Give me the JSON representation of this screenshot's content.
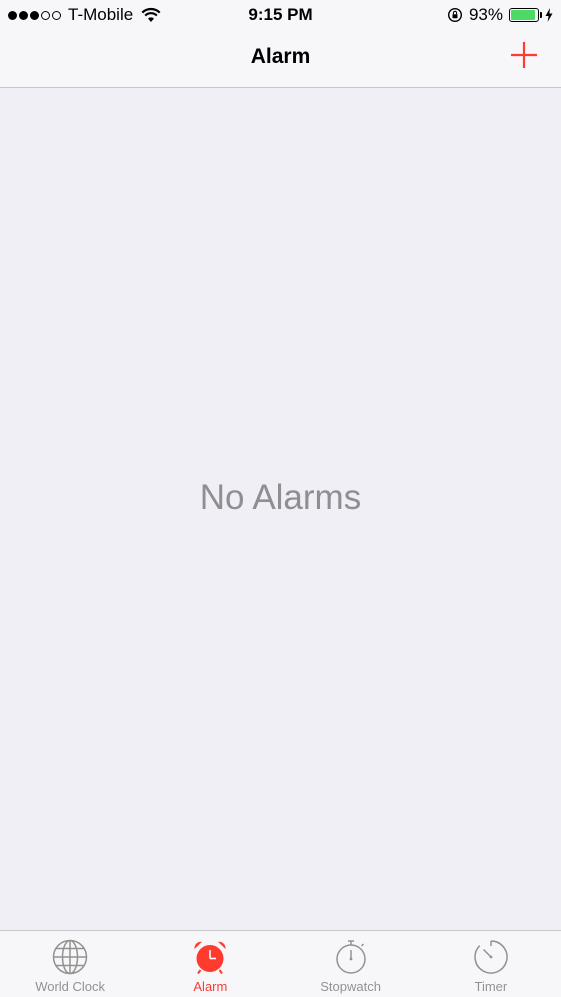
{
  "status_bar": {
    "carrier": "T-Mobile",
    "time": "9:15 PM",
    "battery_percent": "93%",
    "battery_level": 0.93,
    "signal_bars_filled": 3,
    "signal_bars_total": 5
  },
  "nav": {
    "title": "Alarm",
    "add_icon": "plus-icon"
  },
  "main": {
    "empty_message": "No Alarms"
  },
  "tabs": [
    {
      "label": "World Clock",
      "icon": "globe-icon",
      "active": false
    },
    {
      "label": "Alarm",
      "icon": "alarm-clock-icon",
      "active": true
    },
    {
      "label": "Stopwatch",
      "icon": "stopwatch-icon",
      "active": false
    },
    {
      "label": "Timer",
      "icon": "timer-icon",
      "active": false
    }
  ],
  "colors": {
    "accent": "#ff3b30",
    "battery": "#4cd964",
    "inactive_tab": "#929292",
    "background": "#f1eff6"
  }
}
